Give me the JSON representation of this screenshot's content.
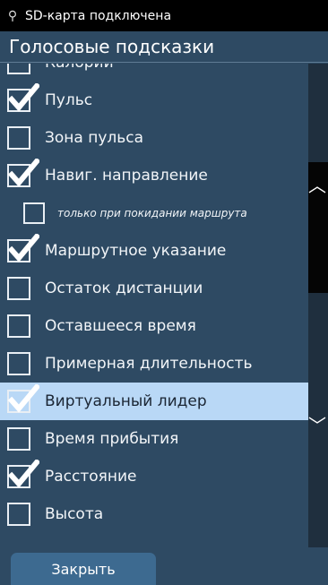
{
  "status_bar": {
    "usb_icon": "usb-icon",
    "text": "SD-карта подключена"
  },
  "header": {
    "title": "Голосовые подсказки"
  },
  "items": [
    {
      "label": "Калории",
      "checked": false,
      "sub": false,
      "highlight": false
    },
    {
      "label": "Пульс",
      "checked": true,
      "sub": false,
      "highlight": false
    },
    {
      "label": "Зона пульса",
      "checked": false,
      "sub": false,
      "highlight": false
    },
    {
      "label": "Навиг. направление",
      "checked": true,
      "sub": false,
      "highlight": false
    },
    {
      "label": "только при покидании маршрута",
      "checked": false,
      "sub": true,
      "highlight": false
    },
    {
      "label": "Маршрутное указание",
      "checked": true,
      "sub": false,
      "highlight": false
    },
    {
      "label": "Остаток дистанции",
      "checked": false,
      "sub": false,
      "highlight": false
    },
    {
      "label": "Оставшееся время",
      "checked": false,
      "sub": false,
      "highlight": false
    },
    {
      "label": "Примерная длительность",
      "checked": false,
      "sub": false,
      "highlight": false
    },
    {
      "label": "Виртуальный лидер",
      "checked": true,
      "sub": false,
      "highlight": true
    },
    {
      "label": "Время прибытия",
      "checked": false,
      "sub": false,
      "highlight": false
    },
    {
      "label": "Расстояние",
      "checked": true,
      "sub": false,
      "highlight": false
    },
    {
      "label": "Высота",
      "checked": false,
      "sub": false,
      "highlight": false
    }
  ],
  "scroll": {
    "up_icon": "chevron-up-icon",
    "down_icon": "chevron-down-icon"
  },
  "footer": {
    "close_label": "Закрыть"
  },
  "colors": {
    "background": "#2e4a63",
    "highlight": "#b9d8f6",
    "button": "#3d6a90"
  }
}
